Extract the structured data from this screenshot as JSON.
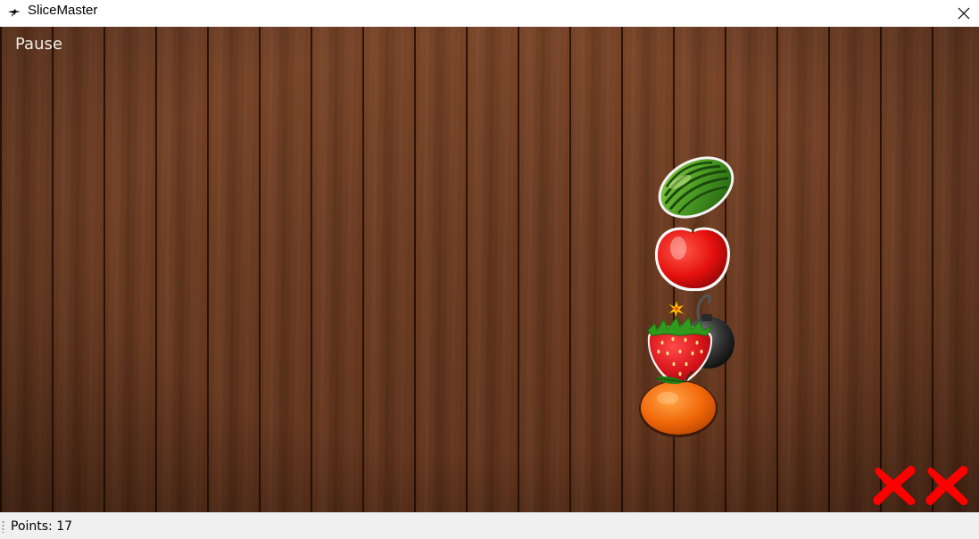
{
  "window": {
    "title": "SliceMaster",
    "icon": "app-icon",
    "close_icon": "close-icon"
  },
  "game": {
    "pause_label": "Pause",
    "objects": [
      {
        "name": "watermelon",
        "icon": "watermelon-icon"
      },
      {
        "name": "apple",
        "icon": "apple-icon"
      },
      {
        "name": "bomb",
        "icon": "bomb-icon"
      },
      {
        "name": "strawberry",
        "icon": "strawberry-icon"
      },
      {
        "name": "orange",
        "icon": "orange-icon"
      }
    ],
    "misses": {
      "count": 2,
      "icon": "red-x-icon",
      "color": "#ff0000"
    },
    "background": "wood-planks"
  },
  "status": {
    "points_text": "Points: 17"
  },
  "colors": {
    "wood": "#6e3d22",
    "miss_x": "#ff0000",
    "status_bg": "#f0f0f0"
  }
}
